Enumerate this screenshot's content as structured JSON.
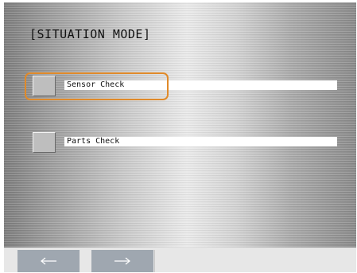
{
  "title": "[SITUATION MODE]",
  "items": [
    {
      "label": "Sensor Check",
      "selected": true
    },
    {
      "label": "Parts Check",
      "selected": false
    }
  ],
  "nav": {
    "back_icon": "arrow-left-icon",
    "forward_icon": "arrow-right-icon"
  },
  "colors": {
    "highlight": "#e08a2a",
    "nav_button": "#9fa7b0"
  }
}
